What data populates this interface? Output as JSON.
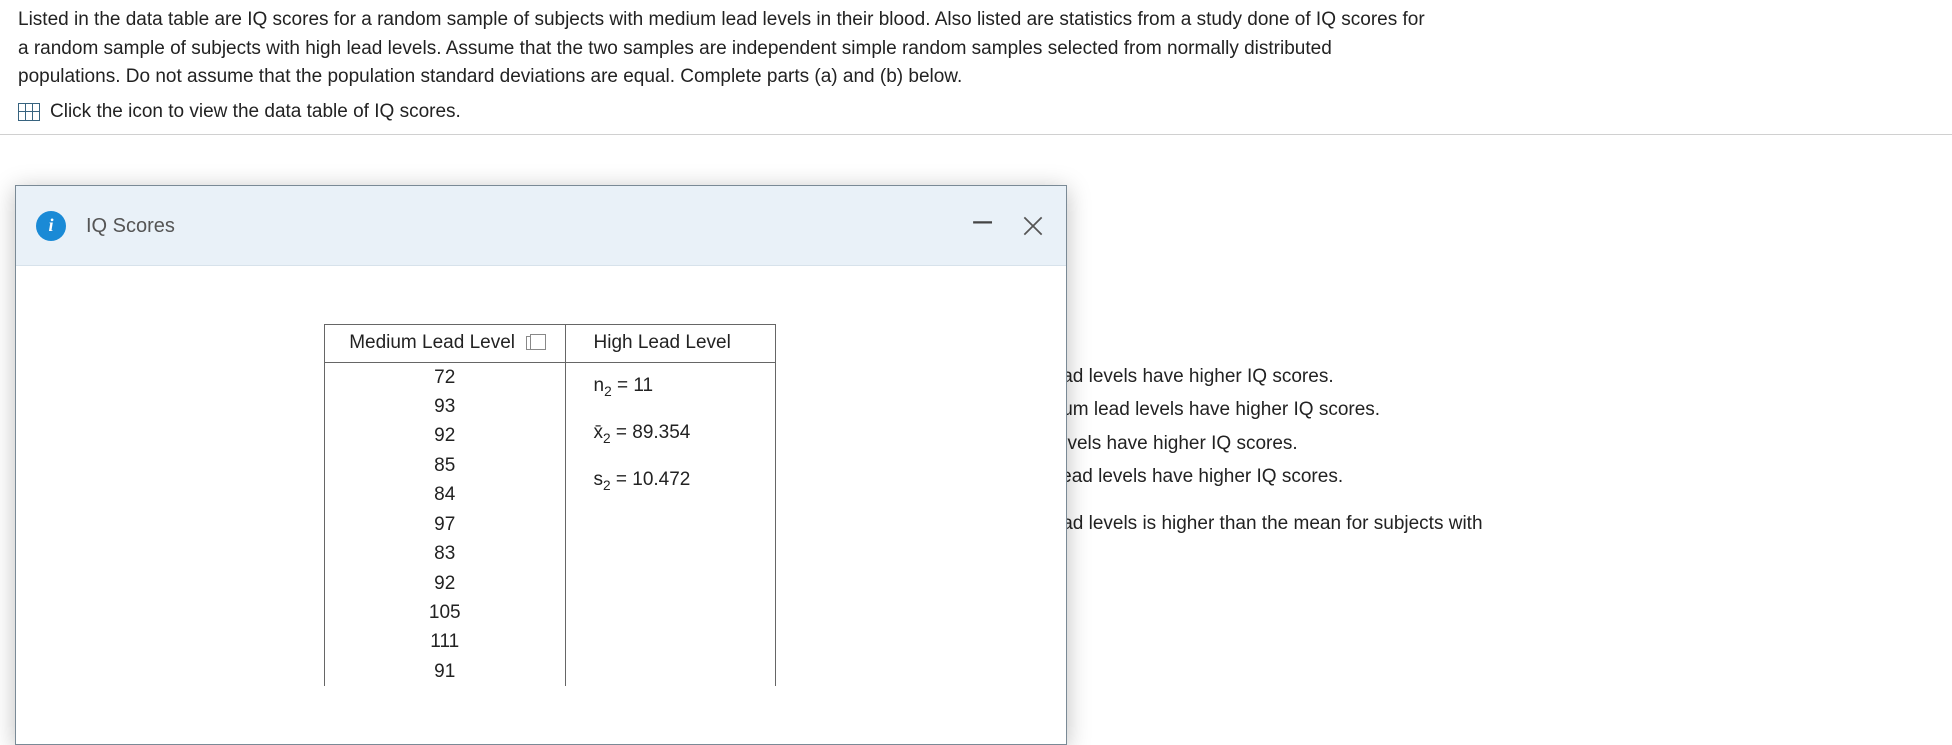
{
  "intro": {
    "line1": "Listed in the data table are IQ scores for a random sample of subjects with medium lead levels in their blood. Also listed are statistics from a study done of IQ scores for",
    "line2": "a random sample of subjects with high lead levels. Assume that the two samples are independent simple random samples selected from normally distributed",
    "line3": "populations. Do not assume that the population standard deviations are equal. Complete parts (a) and (b) below.",
    "link_text": "Click the icon to view the data table of IQ scores."
  },
  "modal": {
    "title": "IQ Scores",
    "columns": {
      "medium": "Medium Lead Level",
      "high": "High Lead Level"
    },
    "medium_values": [
      "72",
      "93",
      "92",
      "85",
      "84",
      "97",
      "83",
      "92",
      "105",
      "111",
      "91"
    ],
    "high_stats": {
      "n_label": "n",
      "n_sub": "2",
      "n_eq": " = 11",
      "x_label": "x̄",
      "x_sub": "2",
      "x_eq": " = 89.354",
      "s_label": "s",
      "s_sub": "2",
      "s_eq": " = 10.472"
    }
  },
  "bg": {
    "l1": "ubjects with medium lead levels have higher IQ scores.",
    "l2": "that subjects with medium lead levels have higher IQ scores.",
    "l3": "cts with medium lead levels have higher IQ scores.",
    "l4": " subjects with medium lead levels have higher IQ scores.",
    "l5": "ubjects with medium lead levels is higher than the mean for subjects with"
  }
}
